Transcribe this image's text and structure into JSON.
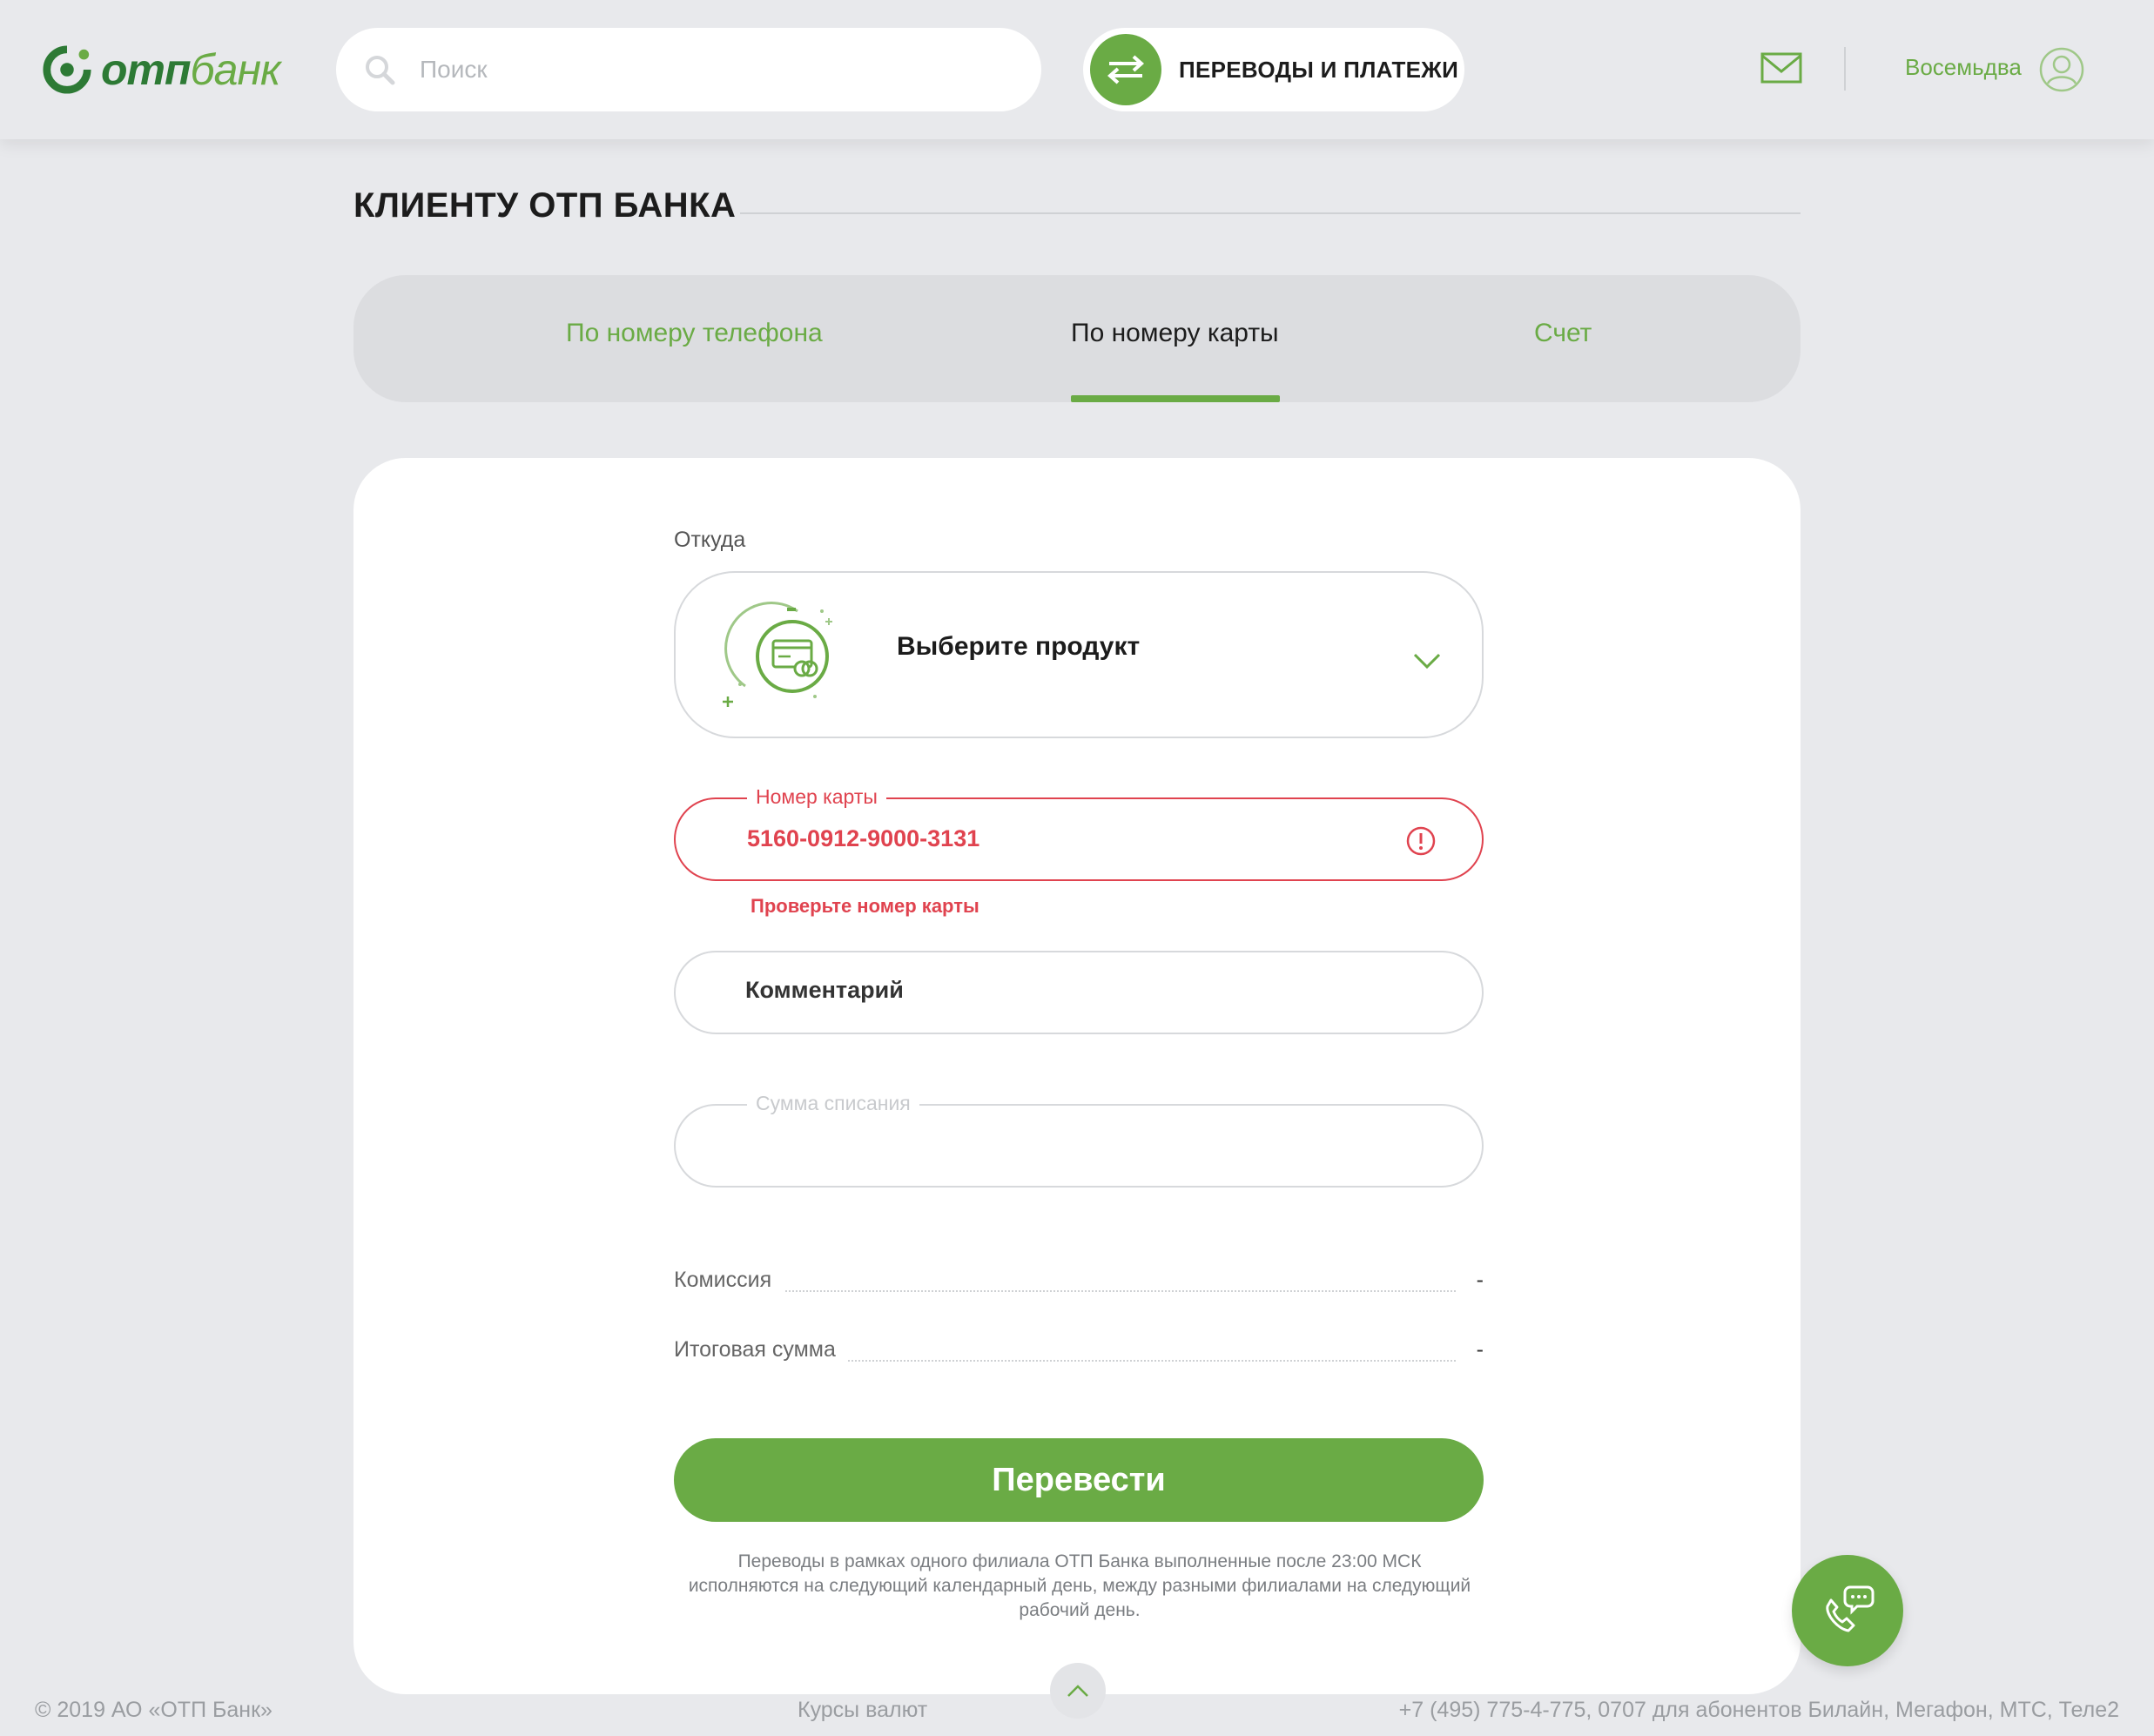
{
  "brand": {
    "otp": "ОТП",
    "bank": "банк"
  },
  "header": {
    "search_placeholder": "Поиск",
    "transfers_label": "ПЕРЕВОДЫ И ПЛАТЕЖИ",
    "user_name": "Восемьдва"
  },
  "page": {
    "title": "КЛИЕНТУ ОТП БАНКА"
  },
  "tabs": [
    {
      "label": "По номеру телефона",
      "active": false
    },
    {
      "label": "По номеру карты",
      "active": true
    },
    {
      "label": "Счет",
      "active": false
    }
  ],
  "form": {
    "from_label": "Откуда",
    "product_placeholder": "Выберите продукт",
    "card_number_label": "Номер карты",
    "card_number_value": "5160-0912-9000-3131",
    "card_error": "Проверьте номер карты",
    "comment_label": "Комментарий",
    "amount_label": "Сумма списания",
    "amount_value": ""
  },
  "summary": {
    "commission_label": "Комиссия",
    "commission_value": "-",
    "total_label": "Итоговая сумма",
    "total_value": "-"
  },
  "submit_label": "Перевести",
  "note": "Переводы в рамках одного филиала ОТП Банка выполненные после 23:00 МСК исполняются на следующий календарный день, между разными филиалами на следующий рабочий день.",
  "footer": {
    "copyright": "© 2019 АО «ОТП Банк»",
    "rates_link": "Курсы валют",
    "phones": "+7 (495) 775-4-775,  0707 для абонентов Билайн, Мегафон, МТС, Теле2"
  },
  "colors": {
    "accent": "#6aab45",
    "accent_dark": "#2d7a35",
    "error": "#e0434f",
    "background": "#e8e9ec"
  },
  "icons": [
    "otp-logo-icon",
    "search-icon",
    "transfer-arrows-icon",
    "mail-icon",
    "user-avatar-icon",
    "card-product-icon",
    "chevron-down-icon",
    "error-exclamation-icon",
    "chevron-up-icon",
    "phone-chat-icon"
  ]
}
